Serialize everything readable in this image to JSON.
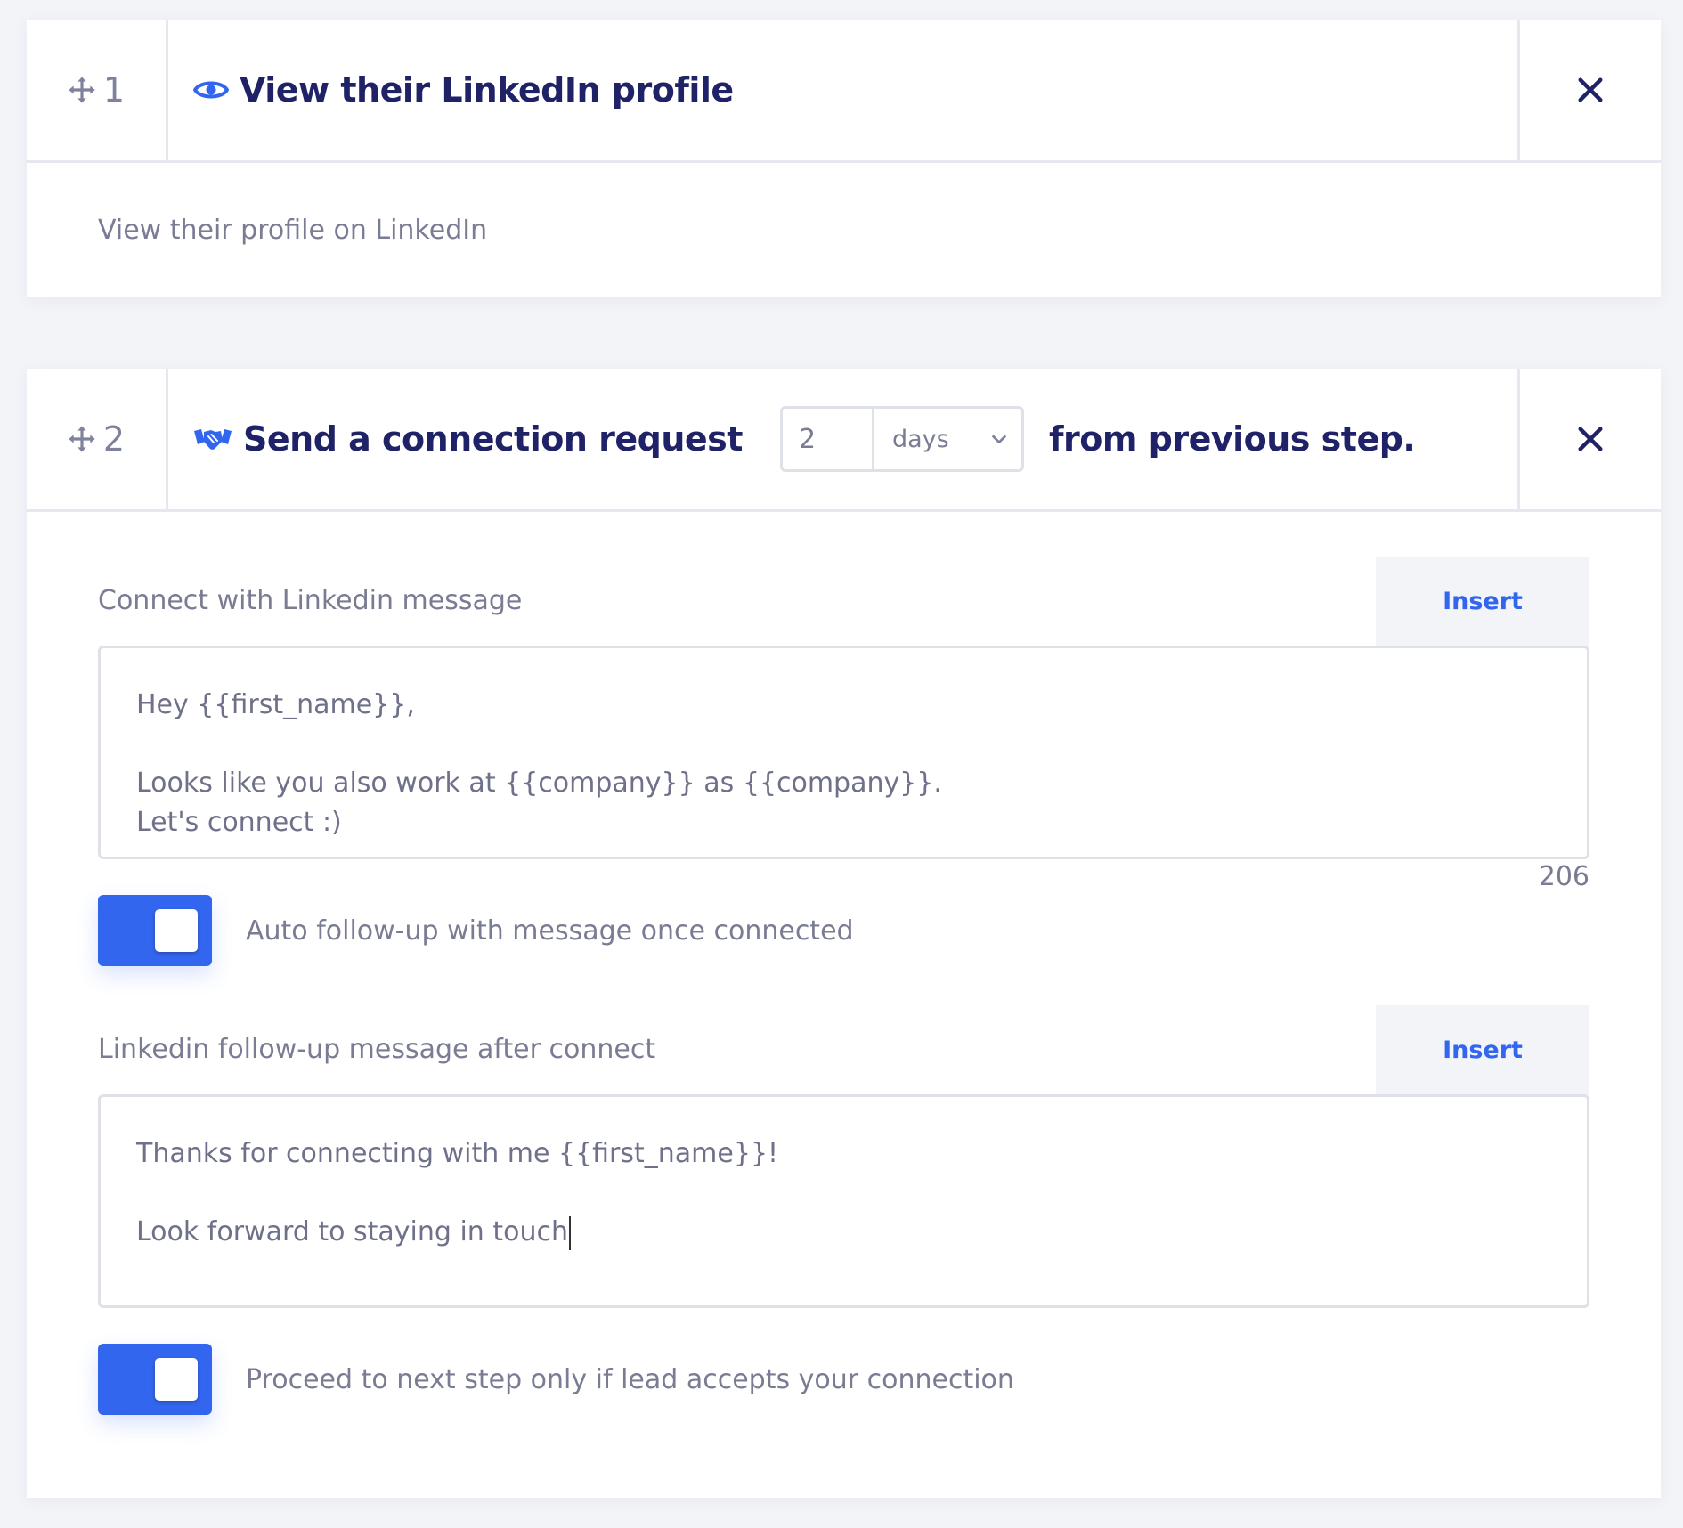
{
  "steps": [
    {
      "number": "1",
      "title": "View their LinkedIn profile",
      "title_icon": "eye-icon",
      "description": "View their profile on LinkedIn"
    },
    {
      "number": "2",
      "title": "Send a connection request",
      "title_icon": "handshake-icon",
      "delay": {
        "value": "2",
        "unit": "days",
        "suffix": "from previous step."
      },
      "connect_message": {
        "label": "Connect with Linkedin message",
        "insert_label": "Insert",
        "text": "Hey {{first_name}},\n\nLooks like you also work at {{company}} as {{company}}.\nLet's connect :)",
        "char_count": "206"
      },
      "auto_follow_up": {
        "label": "Auto follow-up with message once connected",
        "enabled": true
      },
      "follow_up_message": {
        "label": "Linkedin follow-up message after connect",
        "insert_label": "Insert",
        "text": "Thanks for connecting with me {{first_name}}!\n\nLook forward to staying in touch"
      },
      "proceed_only_if_accepted": {
        "label": "Proceed to next step only if lead accepts your connection",
        "enabled": true
      }
    }
  ],
  "colors": {
    "accent": "#3366ee",
    "title": "#1f2266",
    "muted": "#7a7c93",
    "background": "#f3f4f8"
  }
}
